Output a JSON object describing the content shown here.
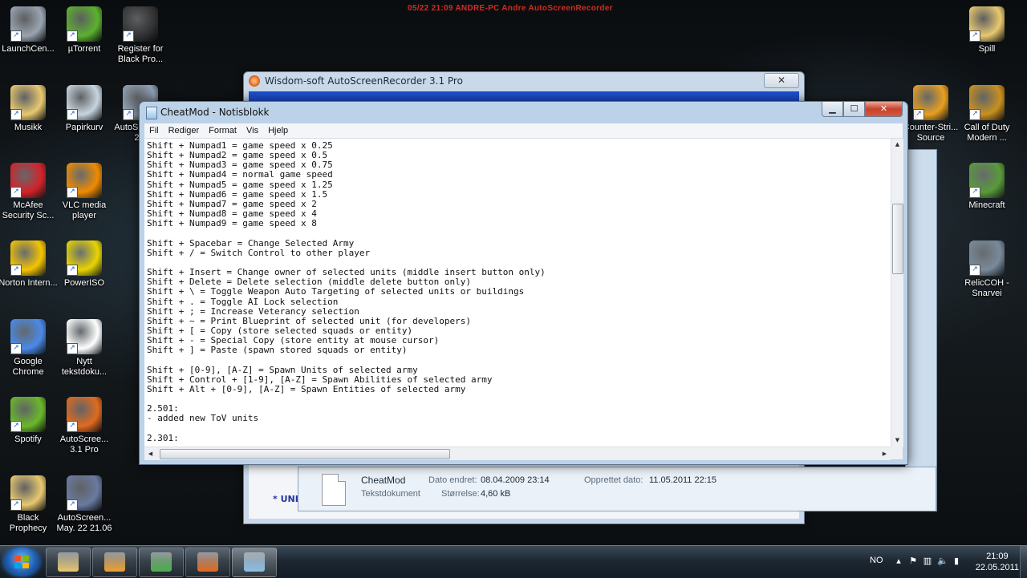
{
  "recorder_banner": "05/22 21:09 ANDRE-PC Andre AutoScreenRecorder",
  "desktop": {
    "left_icons": [
      {
        "label": "LaunchCen...",
        "icon": "launch-center-icon",
        "color": "#9aa4b0"
      },
      {
        "label": "µTorrent",
        "icon": "utorrent-icon",
        "color": "#5bb12f"
      },
      {
        "label": "Register for Black Pro...",
        "icon": "register-icon",
        "color": "#333"
      },
      {
        "label": "Musikk",
        "icon": "folder-icon",
        "color": "#e8c870"
      },
      {
        "label": "Papirkurv",
        "icon": "recycle-bin-icon",
        "color": "#c8d4de"
      },
      {
        "label": "AutoS... May. 2...",
        "icon": "shortcut-icon",
        "color": "#8ea0b4"
      },
      {
        "label": "McAfee Security Sc...",
        "icon": "mcafee-icon",
        "color": "#d2232a"
      },
      {
        "label": "VLC media player",
        "icon": "vlc-icon",
        "color": "#f08a00"
      },
      {
        "label": "Norton Intern...",
        "icon": "norton-icon",
        "color": "#f5c400"
      },
      {
        "label": "PowerISO",
        "icon": "poweriso-icon",
        "color": "#e8d400"
      },
      {
        "label": "Google Chrome",
        "icon": "chrome-icon",
        "color": "#4a8ae8"
      },
      {
        "label": "Nytt tekstdoku...",
        "icon": "text-document-icon",
        "color": "#ffffff"
      },
      {
        "label": "Spotify",
        "icon": "spotify-icon",
        "color": "#6ab82a"
      },
      {
        "label": "AutoScree... 3.1 Pro",
        "icon": "autoscreen-icon",
        "color": "#e06a20"
      },
      {
        "label": "Black Prophecy",
        "icon": "folder-icon",
        "color": "#e8c870"
      },
      {
        "label": "AutoScreen... May. 22 21.06",
        "icon": "video-file-icon",
        "color": "#6a7aa0"
      }
    ],
    "right_icons": [
      {
        "label": "Spill",
        "icon": "folder-icon",
        "color": "#e8c870"
      },
      {
        "label": "Counter-Stri... Source",
        "icon": "counter-strike-icon",
        "color": "#e8a020"
      },
      {
        "label": "Call of Duty Modern ...",
        "icon": "call-of-duty-icon",
        "color": "#c89020"
      },
      {
        "label": "Minecraft",
        "icon": "minecraft-icon",
        "color": "#5a9a3a"
      },
      {
        "label": "RelicCOH - Snarvei",
        "icon": "relic-coh-icon",
        "color": "#7a8a9a"
      }
    ]
  },
  "recorder_window": {
    "title": "Wisdom-soft AutoScreenRecorder 3.1 Pro",
    "close": "✕",
    "bottom_text": "* UNLI"
  },
  "file_details": {
    "name": "CheatMod",
    "type": "Tekstdokument",
    "modified_label": "Dato endret:",
    "modified_value": "08.04.2009 23:14",
    "size_label": "Størrelse:",
    "size_value": "4,60 kB",
    "created_label": "Opprettet dato:",
    "created_value": "11.05.2011 22:15"
  },
  "notepad": {
    "title": "CheatMod - Notisblokk",
    "buttons": {
      "min": "▁",
      "max": "☐",
      "close": "✕"
    },
    "menu": [
      "Fil",
      "Rediger",
      "Format",
      "Vis",
      "Hjelp"
    ],
    "lines": [
      "Shift + Numpad1 = game speed x 0.25",
      "Shift + Numpad2 = game speed x 0.5",
      "Shift + Numpad3 = game speed x 0.75",
      "Shift + Numpad4 = normal game speed",
      "Shift + Numpad5 = game speed x 1.25",
      "Shift + Numpad6 = game speed x 1.5",
      "Shift + Numpad7 = game speed x 2",
      "Shift + Numpad8 = game speed x 4",
      "Shift + Numpad9 = game speed x 8",
      "",
      "Shift + Spacebar = Change Selected Army",
      "Shift + / = Switch Control to other player",
      "",
      "Shift + Insert = Change owner of selected units (middle insert button only)",
      "Shift + Delete = Delete selection (middle delete button only)",
      "Shift + \\ = Toggle Weapon Auto Targeting of selected units or buildings",
      "Shift + . = Toggle AI Lock selection",
      "Shift + ; = Increase Veterancy selection",
      "Shift + ~ = Print Blueprint of selected unit (for developers)",
      "Shift + [ = Copy (store selected squads or entity)",
      "Shift + - = Special Copy (store entity at mouse cursor)",
      "Shift + ] = Paste (spawn stored squads or entity)",
      "",
      "Shift + [0-9], [A-Z] = Spawn Units of selected army",
      "Shift + Control + [1-9], [A-Z] = Spawn Abilities of selected army",
      "Shift + Alt + [0-9], [A-Z] = Spawn Entities of selected army",
      "",
      "2.501:",
      "- added new ToV units",
      "",
      "2.301:"
    ]
  },
  "taskbar": {
    "apps": [
      {
        "name": "explorer",
        "icon": "folder-icon",
        "color": "#e8c870"
      },
      {
        "name": "media",
        "icon": "media-player-icon",
        "color": "#f0a030"
      },
      {
        "name": "messenger",
        "icon": "messenger-icon",
        "color": "#4ab04a"
      },
      {
        "name": "autoscreenrecorder",
        "icon": "autoscreen-icon",
        "color": "#e06a20"
      },
      {
        "name": "notepad",
        "icon": "notepad-icon",
        "color": "#8cc0e8"
      }
    ],
    "language": "NO",
    "time": "21:09",
    "date": "22.05.2011"
  }
}
